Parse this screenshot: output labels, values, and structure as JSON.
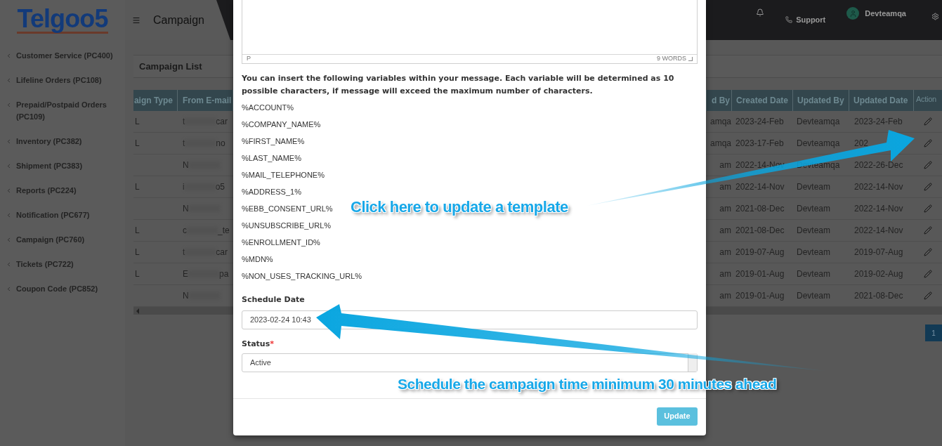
{
  "sidebar": {
    "logo": "Telgoo5",
    "items": [
      {
        "label": "Customer Service (PC400)"
      },
      {
        "label": "Lifeline Orders (PC108)"
      },
      {
        "label": "Prepaid/Postpaid Orders (PC109)"
      },
      {
        "label": "Inventory (PC382)"
      },
      {
        "label": "Shipment (PC383)"
      },
      {
        "label": "Reports (PC224)"
      },
      {
        "label": "Notification (PC677)"
      },
      {
        "label": "Campaign (PC760)"
      },
      {
        "label": "Tickets (PC722)"
      },
      {
        "label": "Coupon Code (PC852)"
      }
    ]
  },
  "header": {
    "page_title": "Campaign",
    "support": "Support",
    "user": "Devteamqa"
  },
  "campaign_list": {
    "title": "Campaign List",
    "columns_left": [
      "aign Type",
      "From E-mail"
    ],
    "columns_right": [
      "d By",
      "Created Date",
      "Updated By",
      "Updated Date",
      "Action"
    ],
    "rows": [
      {
        "type": "L",
        "email_start": "t",
        "email_end": "car",
        "created_by": "amqa",
        "created_date": "2023-24-Feb",
        "updated_by": "Devteamqa",
        "updated_date": "2023-24-Feb"
      },
      {
        "type": "L",
        "email_start": "t",
        "email_end": "no",
        "created_by": "amqa",
        "created_date": "2023-17-Feb",
        "updated_by": "Devteamqa",
        "updated_date": "202"
      },
      {
        "email_start": "N",
        "created_by": "am",
        "created_date": "2022-14-Nov",
        "updated_by": "Devteamqa",
        "updated_date": "2022-26-Dec"
      },
      {
        "type": "L",
        "email_start": "i",
        "email_end": "o5",
        "created_by": "am",
        "created_date": "2022-14-Nov",
        "updated_by": "Devteam",
        "updated_date": "2022-14-Nov"
      },
      {
        "email_start": "N",
        "created_by": "am",
        "created_date": "2021-08-Dec",
        "updated_by": "Devteam",
        "updated_date": "2022-14-Nov"
      },
      {
        "type": "L",
        "email_start": "c",
        "email_end": "_te",
        "created_by": "am",
        "created_date": "2021-08-Dec",
        "updated_by": "Devteam",
        "updated_date": "2022-14-Nov"
      },
      {
        "type": "L",
        "email_start": "t",
        "email_end": "car",
        "created_by": "am",
        "created_date": "2019-07-Aug",
        "updated_by": "Devteam",
        "updated_date": "2019-07-Aug"
      },
      {
        "type": "L",
        "email_start": "E",
        "email_end": "pa",
        "created_by": "am",
        "created_date": "2019-01-Aug",
        "updated_by": "Devteam",
        "updated_date": "2019-02-Aug"
      },
      {
        "email_start": "N",
        "created_by": "am",
        "created_date": "2019-01-Aug",
        "updated_by": "Devteam",
        "updated_date": "2021-08-Dec"
      }
    ],
    "pagination": [
      {
        "label": "1",
        "selected": true
      }
    ]
  },
  "modal": {
    "editor": {
      "path": "P",
      "word_count": "9 WORDS"
    },
    "note": "You can insert the following variables within your message. Each variable will be determined as 10 possible characters, if message will exceed the maximum number of characters.",
    "variables": [
      "%ACCOUNT%",
      "%COMPANY_NAME%",
      "%FIRST_NAME%",
      "%LAST_NAME%",
      "%MAIL_TELEPHONE%",
      "%ADDRESS_1%",
      "%EBB_CONSENT_URL%",
      "%UNSUBSCRIBE_URL%",
      "%ENROLLMENT_ID%",
      "%MDN%",
      "%NON_USES_TRACKING_URL%"
    ],
    "schedule_date": {
      "label": "Schedule Date",
      "value": "2023-02-24 10:43"
    },
    "status": {
      "label": "Status",
      "required_mark": "*",
      "value": "Active"
    },
    "update_button": "Update"
  },
  "annotations": [
    {
      "text": "Click here to update a template"
    },
    {
      "text": "Schedule the campaign time minimum 30 minutes ahead"
    }
  ]
}
